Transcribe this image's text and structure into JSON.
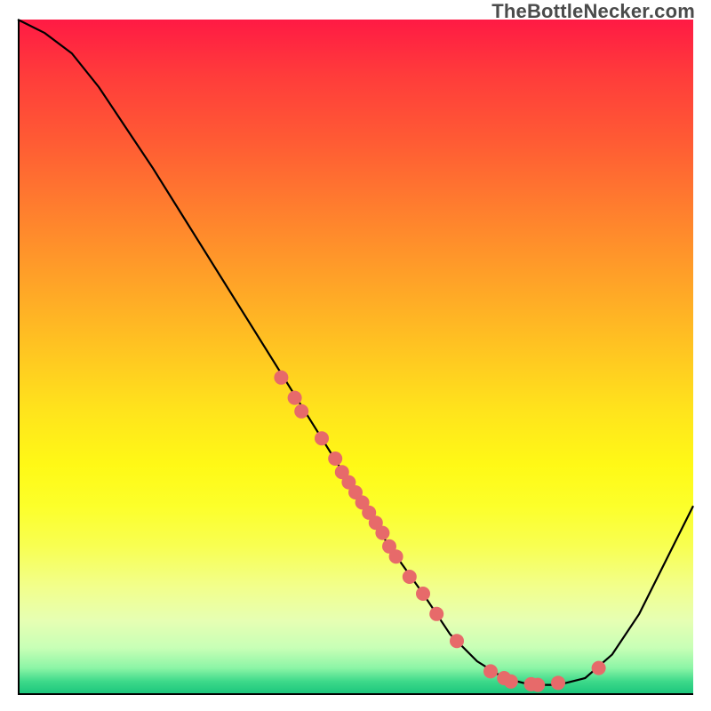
{
  "watermark": "TheBottleNecker.com",
  "chart_data": {
    "type": "line",
    "title": "",
    "xlabel": "",
    "ylabel": "",
    "xlim": [
      0,
      100
    ],
    "ylim": [
      0,
      100
    ],
    "grid": false,
    "legend": false,
    "curve": [
      {
        "x": 0,
        "y": 100
      },
      {
        "x": 4,
        "y": 98
      },
      {
        "x": 8,
        "y": 95
      },
      {
        "x": 12,
        "y": 90
      },
      {
        "x": 16,
        "y": 84
      },
      {
        "x": 20,
        "y": 78
      },
      {
        "x": 25,
        "y": 70
      },
      {
        "x": 30,
        "y": 62
      },
      {
        "x": 35,
        "y": 54
      },
      {
        "x": 40,
        "y": 46
      },
      {
        "x": 45,
        "y": 38
      },
      {
        "x": 50,
        "y": 30
      },
      {
        "x": 55,
        "y": 22
      },
      {
        "x": 60,
        "y": 15
      },
      {
        "x": 64,
        "y": 9
      },
      {
        "x": 68,
        "y": 5
      },
      {
        "x": 72,
        "y": 2.5
      },
      {
        "x": 76,
        "y": 1.5
      },
      {
        "x": 80,
        "y": 1.5
      },
      {
        "x": 84,
        "y": 2.5
      },
      {
        "x": 88,
        "y": 6
      },
      {
        "x": 92,
        "y": 12
      },
      {
        "x": 96,
        "y": 20
      },
      {
        "x": 100,
        "y": 28
      }
    ],
    "points": [
      {
        "x": 39,
        "y": 47
      },
      {
        "x": 41,
        "y": 44
      },
      {
        "x": 42,
        "y": 42
      },
      {
        "x": 45,
        "y": 38
      },
      {
        "x": 47,
        "y": 35
      },
      {
        "x": 48,
        "y": 33
      },
      {
        "x": 49,
        "y": 31.5
      },
      {
        "x": 50,
        "y": 30
      },
      {
        "x": 51,
        "y": 28.5
      },
      {
        "x": 52,
        "y": 27
      },
      {
        "x": 53,
        "y": 25.5
      },
      {
        "x": 54,
        "y": 24
      },
      {
        "x": 55,
        "y": 22
      },
      {
        "x": 56,
        "y": 20.5
      },
      {
        "x": 58,
        "y": 17.5
      },
      {
        "x": 60,
        "y": 15
      },
      {
        "x": 62,
        "y": 12
      },
      {
        "x": 65,
        "y": 8
      },
      {
        "x": 70,
        "y": 3.5
      },
      {
        "x": 72,
        "y": 2.5
      },
      {
        "x": 73,
        "y": 2.0
      },
      {
        "x": 76,
        "y": 1.6
      },
      {
        "x": 77,
        "y": 1.5
      },
      {
        "x": 80,
        "y": 1.8
      },
      {
        "x": 86,
        "y": 4
      }
    ],
    "point_color": "#e76a6a",
    "point_radius": 8,
    "line_color": "#000000",
    "line_width": 2.2
  }
}
